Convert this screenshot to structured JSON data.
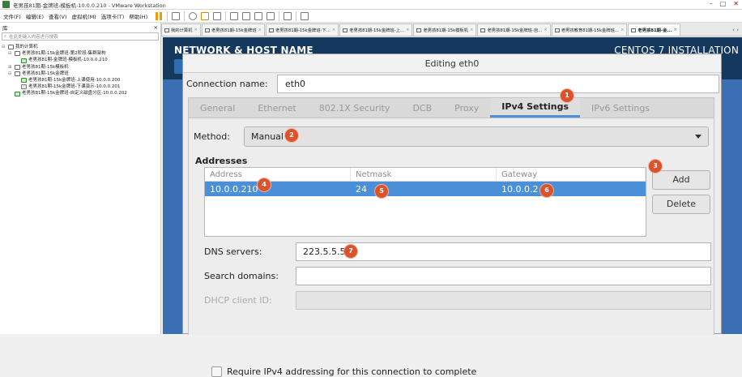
{
  "window": {
    "title": "老男孩81期-金牌班-模板机-10.0.0.210 - VMware Workstation",
    "controls": [
      "–",
      "□",
      "✕"
    ]
  },
  "menu": [
    "文件(F)",
    "编辑(E)",
    "查看(V)",
    "虚拟机(M)",
    "选项卡(T)",
    "帮助(H)"
  ],
  "sidebar": {
    "header": "库",
    "search_placeholder": "在此处键入内容进行搜索",
    "tree": [
      {
        "label": "我的计算机",
        "level": 0,
        "expander": "⊟",
        "icon": "computer"
      },
      {
        "label": "老男孩81期-15k金牌班-第2阶段-集群架构",
        "level": 1,
        "expander": "⊟",
        "icon": "folder"
      },
      {
        "label": "老男孩81期-金牌班-模板机-10.0.0.210",
        "level": 2,
        "expander": "",
        "icon": "vm"
      },
      {
        "label": "老男孩81期-15k模板机",
        "level": 1,
        "expander": "⊞",
        "icon": "folder"
      },
      {
        "label": "老男孩81期-15k金牌班",
        "level": 1,
        "expander": "⊟",
        "icon": "folder"
      },
      {
        "label": "老男孩81期-15k金牌班-上课使用-10.0.0.200",
        "level": 2,
        "expander": "",
        "icon": "vm"
      },
      {
        "label": "老男孩81期-15k金牌班-下课演示-10.0.0.201",
        "level": 2,
        "expander": "",
        "icon": "vm-off"
      },
      {
        "label": "老男孩81期-15k金牌班-自定义磁盘分区-10.0.0.202",
        "level": 1,
        "expander": "",
        "icon": "vm"
      }
    ]
  },
  "tabs": [
    {
      "label": "我的计算机",
      "active": false
    },
    {
      "label": "老男孩81期-15k金牌班",
      "active": false
    },
    {
      "label": "老男孩81期-15k金牌班-下...",
      "active": false
    },
    {
      "label": "老男孩81期-15k金牌班-上...",
      "active": false
    },
    {
      "label": "老男孩81期-15k模板机",
      "active": false
    },
    {
      "label": "老男孩81期-15k金牌班-自...",
      "active": false
    },
    {
      "label": "老男孩教育81期-15k金牌班...",
      "active": false
    },
    {
      "label": "老男孩81期-金...",
      "active": true
    }
  ],
  "anaconda": {
    "left_title": "NETWORK & HOST NAME",
    "right_title": "CENTOS 7 INSTALLATION"
  },
  "dialog": {
    "title": "Editing eth0",
    "connection_name_label": "Connection name:",
    "connection_name_value": "eth0",
    "tabs": [
      "General",
      "Ethernet",
      "802.1X Security",
      "DCB",
      "Proxy",
      "IPv4 Settings",
      "IPv6 Settings"
    ],
    "active_tab": "IPv4 Settings",
    "method_label": "Method:",
    "method_value": "Manual",
    "addresses_heading": "Addresses",
    "address_columns": [
      "Address",
      "Netmask",
      "Gateway"
    ],
    "address_rows": [
      {
        "address": "10.0.0.210",
        "netmask": "24",
        "gateway": "10.0.0.2"
      }
    ],
    "add_button": "Add",
    "delete_button": "Delete",
    "dns_label": "DNS servers:",
    "dns_value": "223.5.5.5",
    "search_domains_label": "Search domains:",
    "search_domains_value": "",
    "dhcp_client_id_label": "DHCP client ID:",
    "dhcp_client_id_value": "",
    "require_ipv4_label": "Require IPv4 addressing for this connection to complete",
    "require_ipv4_checked": false
  },
  "badges": [
    "1",
    "2",
    "3",
    "4",
    "5",
    "6",
    "7"
  ],
  "colors": {
    "badge": "#d9532c",
    "selection": "#4a90d9",
    "anaconda_header": "#15385e",
    "vm_background": "#3c6eb4"
  }
}
